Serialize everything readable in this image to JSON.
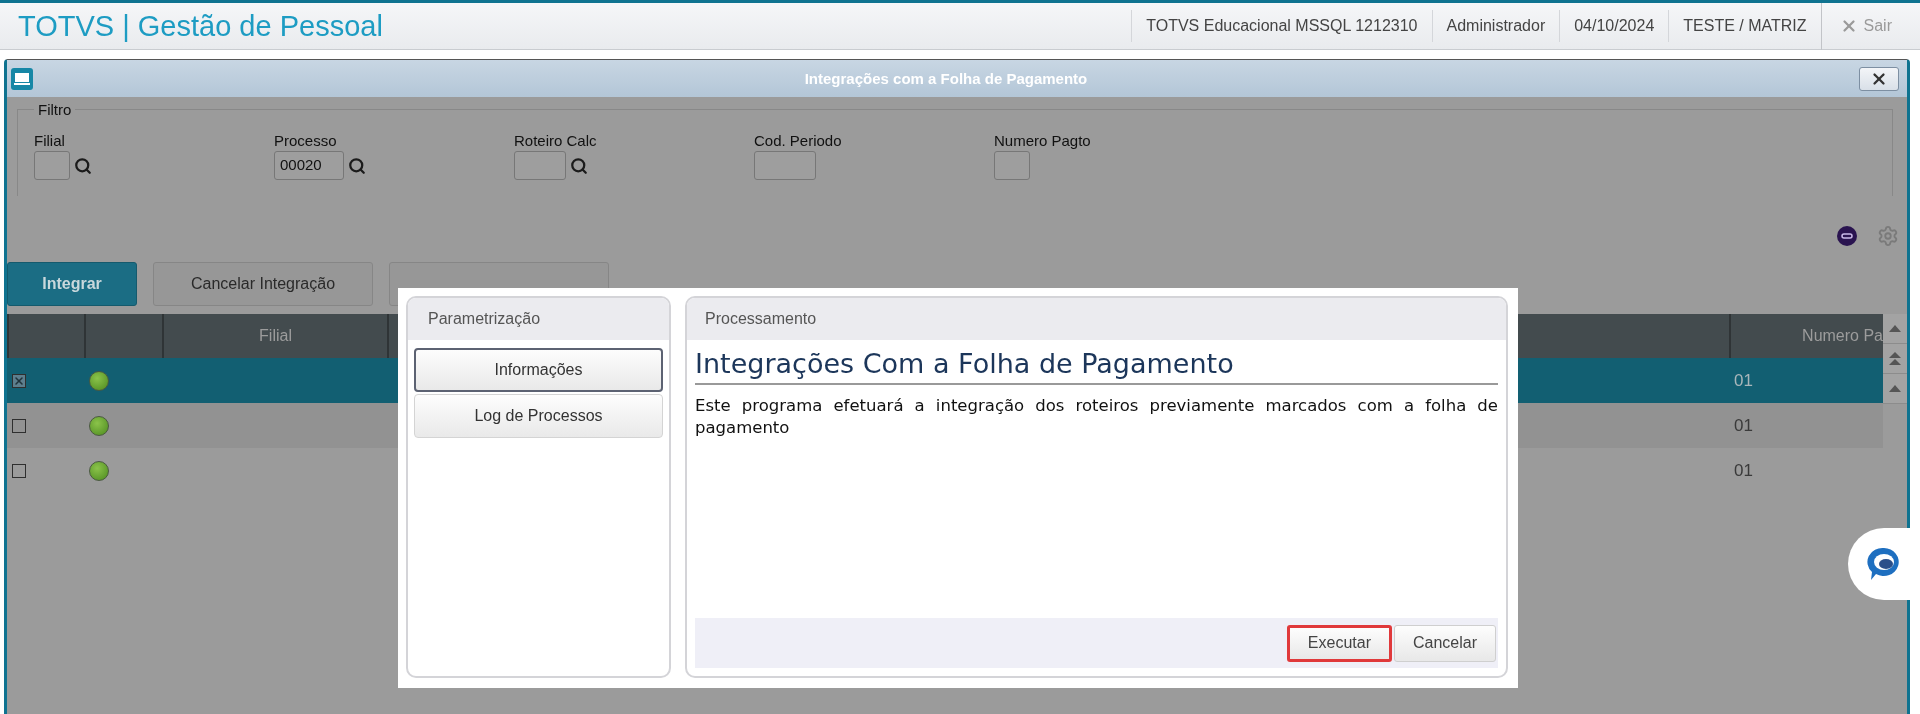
{
  "app": {
    "title": "TOTVS | Gestão de Pessoal",
    "status": [
      "TOTVS Educacional MSSQL 1212310",
      "Administrador",
      "04/10/2024",
      "TESTE / MATRIZ"
    ],
    "exit": "Sair"
  },
  "window": {
    "title": "Integrações com a Folha de Pagamento"
  },
  "filter": {
    "legend": "Filtro",
    "fields": [
      {
        "label": "Filial",
        "lookup": true
      },
      {
        "label": "Processo",
        "value": "00020",
        "lookup": true
      },
      {
        "label": "Roteiro Calc",
        "lookup": true
      },
      {
        "label": "Cod. Periodo",
        "lookup": false
      },
      {
        "label": "Numero Pagto",
        "lookup": false
      }
    ]
  },
  "actions": [
    {
      "label": "Integrar",
      "primary": true
    },
    {
      "label": "Cancelar Integração",
      "primary": false
    },
    {
      "primary": false
    }
  ],
  "table": {
    "columns": [
      {
        "label": "Filial"
      },
      {
        "label": "Numero Pa"
      }
    ],
    "rows": [
      {
        "selected": true,
        "checked": true,
        "numero": "01"
      },
      {
        "selected": false,
        "checked": false,
        "numero": "01"
      },
      {
        "selected": false,
        "checked": false,
        "numero": "01"
      }
    ]
  },
  "dialog": {
    "nav_title": "Parametrização",
    "nav": [
      {
        "label": "Informações",
        "selected": true
      },
      {
        "label": "Log de Processos",
        "selected": false
      }
    ],
    "panel_title": "Processamento",
    "heading": "Integrações Com a Folha de Pagamento",
    "text": "Este programa efetuará a integração dos roteiros previamente marcados com a folha de pagamento",
    "buttons": [
      {
        "label": "Executar",
        "highlighted": true
      },
      {
        "label": "Cancelar",
        "highlighted": false
      }
    ]
  }
}
